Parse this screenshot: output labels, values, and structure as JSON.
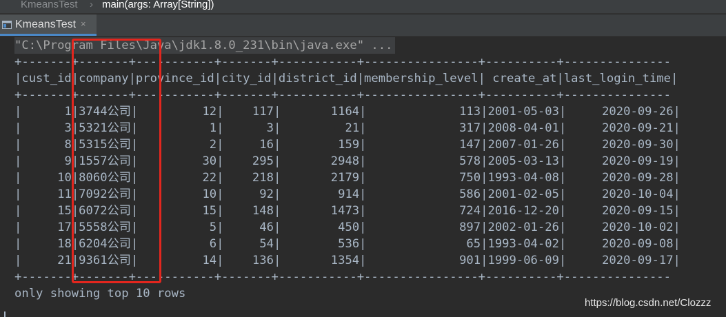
{
  "breadcrumb": {
    "project": "KmeansTest",
    "separator": "›",
    "method": "main(args: Array[String])"
  },
  "run_tab": {
    "label": "KmeansTest",
    "close": "×",
    "icon": "run-console-icon"
  },
  "console": {
    "command": "\"C:\\Program Files\\Java\\jdk1.8.0_231\\bin\\java.exe\" ...",
    "table_border": "+-------+-------+-----------+-------+-----------+----------------+----------+---------------",
    "header_line": "|cust_id|company|province_id|city_id|district_id|membership_level| create_at|last_login_time|",
    "columns": [
      "cust_id",
      "company",
      "province_id",
      "city_id",
      "district_id",
      "membership_level",
      "create_at",
      "last_login_time"
    ],
    "rows": [
      {
        "cust_id": "1",
        "company": "3744公司",
        "province_id": "12",
        "city_id": "117",
        "district_id": "1164",
        "membership_level": "113",
        "create_at": "2001-05-03",
        "last_login_time": "2020-09-26"
      },
      {
        "cust_id": "3",
        "company": "5321公司",
        "province_id": "1",
        "city_id": "3",
        "district_id": "21",
        "membership_level": "317",
        "create_at": "2008-04-01",
        "last_login_time": "2020-09-21"
      },
      {
        "cust_id": "8",
        "company": "5315公司",
        "province_id": "2",
        "city_id": "16",
        "district_id": "159",
        "membership_level": "147",
        "create_at": "2007-01-26",
        "last_login_time": "2020-09-30"
      },
      {
        "cust_id": "9",
        "company": "1557公司",
        "province_id": "30",
        "city_id": "295",
        "district_id": "2948",
        "membership_level": "578",
        "create_at": "2005-03-13",
        "last_login_time": "2020-09-19"
      },
      {
        "cust_id": "10",
        "company": "8060公司",
        "province_id": "22",
        "city_id": "218",
        "district_id": "2179",
        "membership_level": "750",
        "create_at": "1993-04-08",
        "last_login_time": "2020-09-28"
      },
      {
        "cust_id": "11",
        "company": "7092公司",
        "province_id": "10",
        "city_id": "92",
        "district_id": "914",
        "membership_level": "586",
        "create_at": "2001-02-05",
        "last_login_time": "2020-10-04"
      },
      {
        "cust_id": "15",
        "company": "6072公司",
        "province_id": "15",
        "city_id": "148",
        "district_id": "1473",
        "membership_level": "724",
        "create_at": "2016-12-20",
        "last_login_time": "2020-09-15"
      },
      {
        "cust_id": "17",
        "company": "5558公司",
        "province_id": "5",
        "city_id": "46",
        "district_id": "450",
        "membership_level": "897",
        "create_at": "2002-01-26",
        "last_login_time": "2020-10-02"
      },
      {
        "cust_id": "18",
        "company": "6204公司",
        "province_id": "6",
        "city_id": "54",
        "district_id": "536",
        "membership_level": "65",
        "create_at": "1993-04-02",
        "last_login_time": "2020-09-08"
      },
      {
        "cust_id": "21",
        "company": "9361公司",
        "province_id": "14",
        "city_id": "136",
        "district_id": "1354",
        "membership_level": "901",
        "create_at": "1999-06-09",
        "last_login_time": "2020-09-17"
      }
    ],
    "footer": "only showing top 10 rows"
  },
  "watermark": "https://blog.csdn.net/Clozzz",
  "colors": {
    "console_bg": "#2b2b2b",
    "console_text": "#a9b7c6",
    "annotation_box": "#e3261e",
    "tab_accent": "#4a88c7"
  }
}
